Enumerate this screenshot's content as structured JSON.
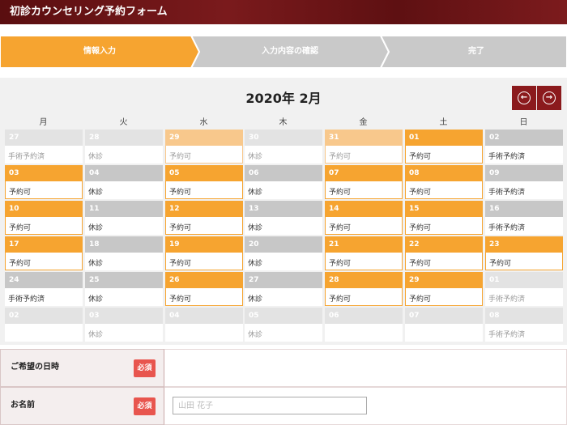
{
  "header": {
    "title": "初診カウンセリング予約フォーム"
  },
  "steps": [
    "情報入力",
    "入力内容の確認",
    "完了"
  ],
  "calendar": {
    "title": "2020年 2月",
    "weekdays": [
      "月",
      "火",
      "水",
      "木",
      "金",
      "土",
      "日"
    ],
    "weeks": [
      [
        {
          "d": "27",
          "s": "手術予約済",
          "t": "closed",
          "o": true
        },
        {
          "d": "28",
          "s": "休診",
          "t": "closed",
          "o": true
        },
        {
          "d": "29",
          "s": "予約可",
          "t": "avail",
          "o": true
        },
        {
          "d": "30",
          "s": "休診",
          "t": "closed",
          "o": true
        },
        {
          "d": "31",
          "s": "予約可",
          "t": "avail",
          "o": true
        },
        {
          "d": "01",
          "s": "予約可",
          "t": "avail",
          "o": false
        },
        {
          "d": "02",
          "s": "手術予約済",
          "t": "closed",
          "o": false
        }
      ],
      [
        {
          "d": "03",
          "s": "予約可",
          "t": "avail",
          "o": false
        },
        {
          "d": "04",
          "s": "休診",
          "t": "closed",
          "o": false
        },
        {
          "d": "05",
          "s": "予約可",
          "t": "avail",
          "o": false
        },
        {
          "d": "06",
          "s": "休診",
          "t": "closed",
          "o": false
        },
        {
          "d": "07",
          "s": "予約可",
          "t": "avail",
          "o": false
        },
        {
          "d": "08",
          "s": "予約可",
          "t": "avail",
          "o": false
        },
        {
          "d": "09",
          "s": "手術予約済",
          "t": "closed",
          "o": false
        }
      ],
      [
        {
          "d": "10",
          "s": "予約可",
          "t": "avail",
          "o": false
        },
        {
          "d": "11",
          "s": "休診",
          "t": "closed",
          "o": false
        },
        {
          "d": "12",
          "s": "予約可",
          "t": "avail",
          "o": false
        },
        {
          "d": "13",
          "s": "休診",
          "t": "closed",
          "o": false
        },
        {
          "d": "14",
          "s": "予約可",
          "t": "avail",
          "o": false
        },
        {
          "d": "15",
          "s": "予約可",
          "t": "avail",
          "o": false
        },
        {
          "d": "16",
          "s": "手術予約済",
          "t": "closed",
          "o": false
        }
      ],
      [
        {
          "d": "17",
          "s": "予約可",
          "t": "avail",
          "o": false
        },
        {
          "d": "18",
          "s": "休診",
          "t": "closed",
          "o": false
        },
        {
          "d": "19",
          "s": "予約可",
          "t": "avail",
          "o": false
        },
        {
          "d": "20",
          "s": "休診",
          "t": "closed",
          "o": false
        },
        {
          "d": "21",
          "s": "予約可",
          "t": "avail",
          "o": false
        },
        {
          "d": "22",
          "s": "予約可",
          "t": "avail",
          "o": false
        },
        {
          "d": "23",
          "s": "予約可",
          "t": "avail",
          "o": false
        }
      ],
      [
        {
          "d": "24",
          "s": "手術予約済",
          "t": "closed",
          "o": false
        },
        {
          "d": "25",
          "s": "休診",
          "t": "closed",
          "o": false
        },
        {
          "d": "26",
          "s": "予約可",
          "t": "avail",
          "o": false
        },
        {
          "d": "27",
          "s": "休診",
          "t": "closed",
          "o": false
        },
        {
          "d": "28",
          "s": "予約可",
          "t": "avail",
          "o": false
        },
        {
          "d": "29",
          "s": "予約可",
          "t": "avail",
          "o": false
        },
        {
          "d": "01",
          "s": "手術予約済",
          "t": "closed",
          "o": true
        }
      ],
      [
        {
          "d": "02",
          "s": "",
          "t": "closed",
          "o": true
        },
        {
          "d": "03",
          "s": "休診",
          "t": "closed",
          "o": true
        },
        {
          "d": "04",
          "s": "",
          "t": "closed",
          "o": true
        },
        {
          "d": "05",
          "s": "休診",
          "t": "closed",
          "o": true
        },
        {
          "d": "06",
          "s": "",
          "t": "closed",
          "o": true
        },
        {
          "d": "07",
          "s": "",
          "t": "closed",
          "o": true
        },
        {
          "d": "08",
          "s": "手術予約済",
          "t": "closed",
          "o": true
        }
      ]
    ]
  },
  "form": {
    "date_label": "ご希望の日時",
    "name_label": "お名前",
    "required": "必須",
    "name_placeholder": "山田 花子"
  }
}
